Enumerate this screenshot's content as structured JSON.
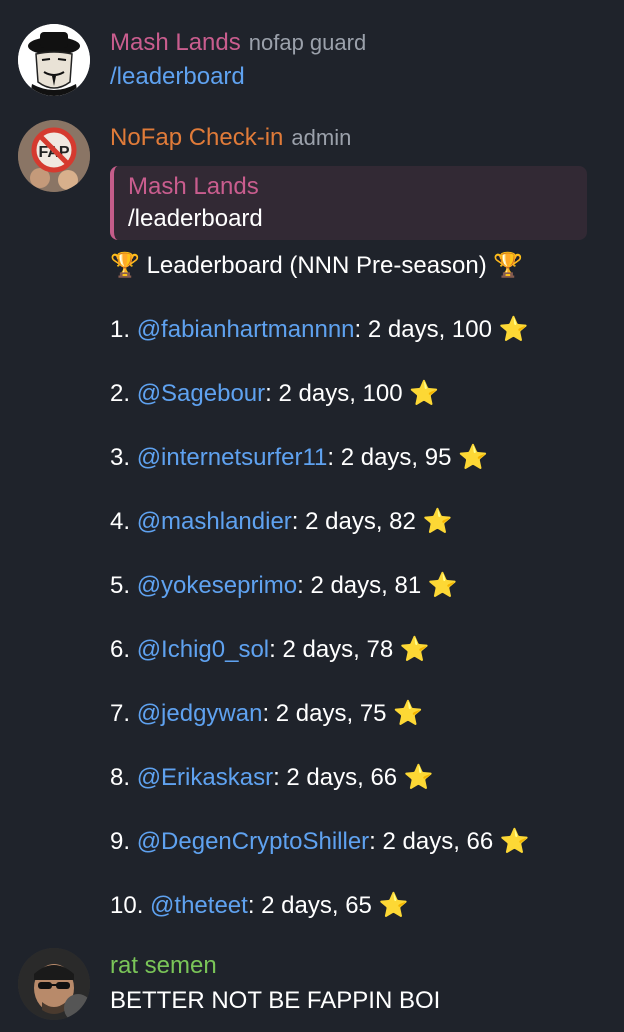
{
  "messages": [
    {
      "sender": "Mash Lands",
      "role": "nofap guard",
      "text": "/leaderboard",
      "color": "#c95d8e"
    },
    {
      "sender": "NoFap Check-in",
      "role": "admin",
      "color": "#e07b39",
      "reply": {
        "name": "Mash Lands",
        "text": "/leaderboard"
      },
      "title": "Leaderboard (NNN Pre-season)",
      "trophy_icon": "🏆",
      "star_icon": "⭐",
      "rows": [
        {
          "rank": "1.",
          "handle": "@fabianhartmannnn",
          "stats": ": 2 days, 100"
        },
        {
          "rank": "2.",
          "handle": "@Sagebour",
          "stats": ": 2 days, 100"
        },
        {
          "rank": "3.",
          "handle": "@internetsurfer11",
          "stats": ": 2 days, 95"
        },
        {
          "rank": "4.",
          "handle": "@mashlandier",
          "stats": ": 2 days, 82"
        },
        {
          "rank": "5.",
          "handle": "@yokeseprimo",
          "stats": ": 2 days, 81"
        },
        {
          "rank": "6.",
          "handle": "@Ichig0_sol",
          "stats": ": 2 days, 78"
        },
        {
          "rank": "7.",
          "handle": "@jedgywan",
          "stats": ": 2 days, 75"
        },
        {
          "rank": "8.",
          "handle": "@Erikaskasr",
          "stats": ": 2 days, 66"
        },
        {
          "rank": "9.",
          "handle": "@DegenCryptoShiller",
          "stats": ": 2 days, 66"
        },
        {
          "rank": "10.",
          "handle": "@theteet",
          "stats": ": 2 days, 65"
        }
      ]
    },
    {
      "sender": "rat semen",
      "text": "BETTER NOT BE FAPPIN BOI",
      "color": "#7ac558"
    }
  ],
  "colors": {
    "background": "#1f232b",
    "link": "#5fa2f0",
    "role": "#9ba1ab",
    "reply_bg": "#322934",
    "reply_bar": "#c55d8a"
  },
  "avatars": {
    "mash": "guy-fawkes-mask-avatar",
    "nofap": "no-fap-sign-avatar",
    "rat": "man-with-sunglasses-avatar"
  }
}
